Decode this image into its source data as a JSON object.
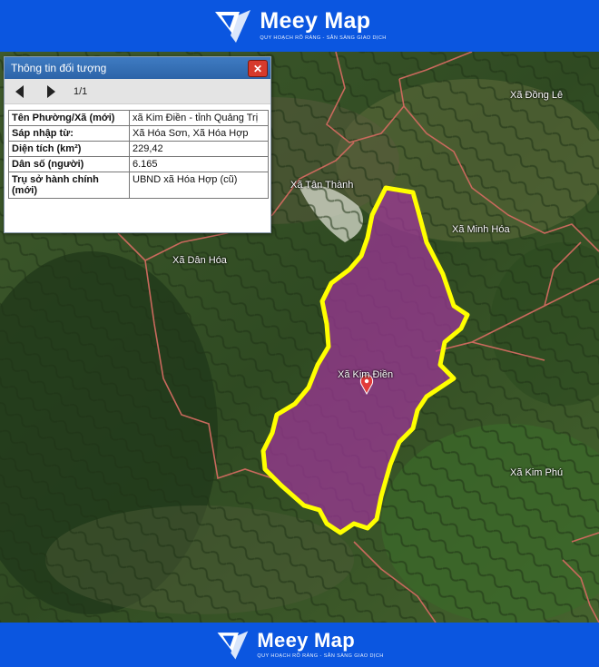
{
  "header": {
    "brand": "Meey Map",
    "tagline": "QUY HOẠCH RÕ RÀNG - SẴN SÀNG GIAO DỊCH"
  },
  "footer": {
    "brand": "Meey Map",
    "tagline": "QUY HOẠCH RÕ RÀNG - SẴN SÀNG GIAO DỊCH"
  },
  "popup": {
    "title": "Thông tin đối tượng",
    "close": "✕",
    "pager": "1/1",
    "rows": [
      {
        "key": "Tên Phường/Xã (mới)",
        "value": "xã Kim Điền - tỉnh Quảng Trị"
      },
      {
        "key": "Sáp nhập từ:",
        "value": "Xã Hóa Sơn, Xã Hóa Hợp"
      },
      {
        "key": "Diện tích (km²)",
        "value": "229,42"
      },
      {
        "key": "Dân số (người)",
        "value": "6.165"
      },
      {
        "key": "Trụ sở hành chính (mới)",
        "value": "UBND xã Hóa Hợp (cũ)"
      }
    ]
  },
  "map": {
    "places": [
      "Xã Đồng Lê",
      "Xã Tân Thành",
      "Xã Minh Hóa",
      "Xã Dân Hóa",
      "Xã Kim Điền",
      "Xã Kim Phú"
    ],
    "highlight_color": "#ffff00",
    "fill_color": "#a0349a",
    "boundary_color": "#c9695d"
  }
}
